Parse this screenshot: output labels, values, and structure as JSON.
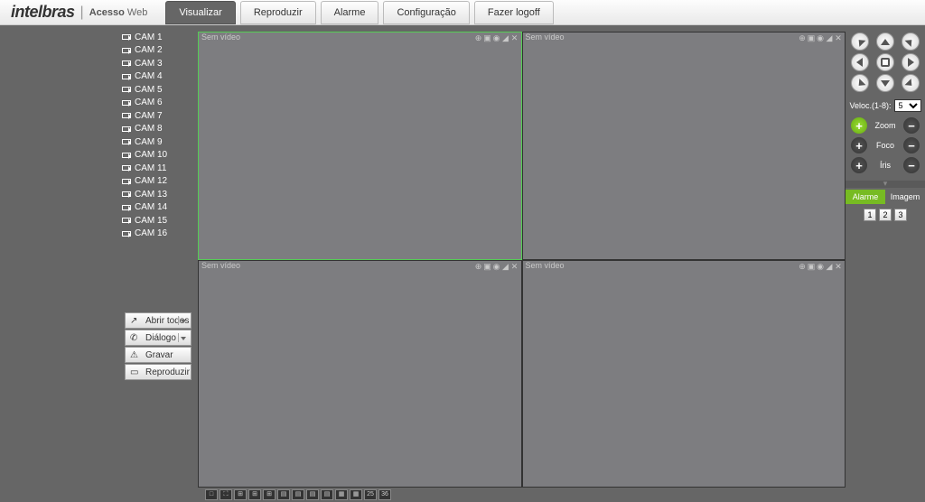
{
  "header": {
    "brand": "intelbras",
    "access": "Acesso",
    "web": "Web",
    "tabs": {
      "visualizar": "Visualizar",
      "reproduzir": "Reproduzir",
      "alarme": "Alarme",
      "configuracao": "Configuração",
      "logoff": "Fazer logoff"
    }
  },
  "sidebar": {
    "cams": [
      "CAM 1",
      "CAM 2",
      "CAM 3",
      "CAM 4",
      "CAM 5",
      "CAM 6",
      "CAM 7",
      "CAM 8",
      "CAM 9",
      "CAM 10",
      "CAM 11",
      "CAM 12",
      "CAM 13",
      "CAM 14",
      "CAM 15",
      "CAM 16"
    ],
    "buttons": {
      "open_all": "Abrir todos",
      "dialog": "Diálogo",
      "record": "Gravar",
      "reproduce": "Reproduzir"
    }
  },
  "video": {
    "no_video": "Sem vídeo"
  },
  "layout_buttons": [
    "□",
    "⛶",
    "⊞",
    "⊞",
    "⊞",
    "▤",
    "▤",
    "▤",
    "▤",
    "▦",
    "▦",
    "25",
    "36"
  ],
  "ptz": {
    "speed_label": "Veloc.(1-8):",
    "speed_value": "5",
    "zoom": "Zoom",
    "foco": "Foco",
    "iris": "Íris",
    "alarme": "Alarme",
    "imagem": "Imagem",
    "nums": [
      "1",
      "2",
      "3"
    ]
  }
}
